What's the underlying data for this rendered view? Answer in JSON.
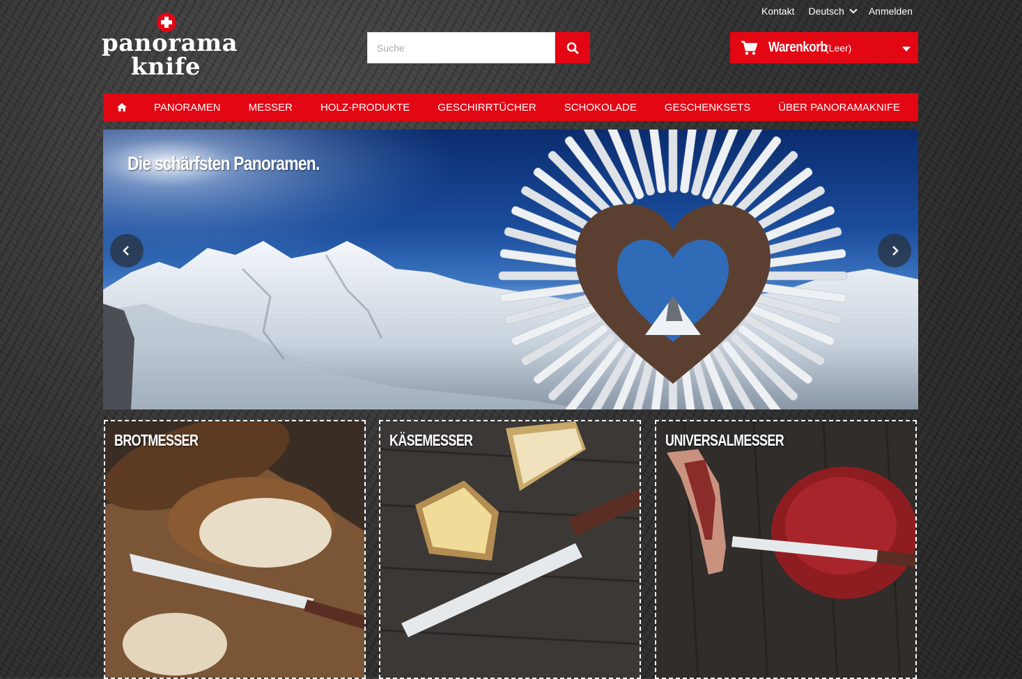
{
  "top_links": {
    "contact": "Kontakt",
    "language": "Deutsch",
    "login": "Anmelden"
  },
  "logo": {
    "line1": "panorama",
    "line2": "knife"
  },
  "search": {
    "placeholder": "Suche"
  },
  "cart": {
    "label": "Warenkorb",
    "status": "(Leer)"
  },
  "nav": {
    "items": [
      "PANORAMEN",
      "MESSER",
      "HOLZ-PRODUKTE",
      "GESCHIRRTÜCHER",
      "SCHOKOLADE",
      "GESCHENKSETS",
      "ÜBER PANORAMAKNIFE"
    ]
  },
  "slider": {
    "caption": "Die schärfsten Panoramen."
  },
  "categories": [
    {
      "title": "BROTMESSER"
    },
    {
      "title": "KÄSEMESSER"
    },
    {
      "title": "UNIVERSALMESSER"
    }
  ],
  "colors": {
    "brand_red": "#e30613"
  }
}
